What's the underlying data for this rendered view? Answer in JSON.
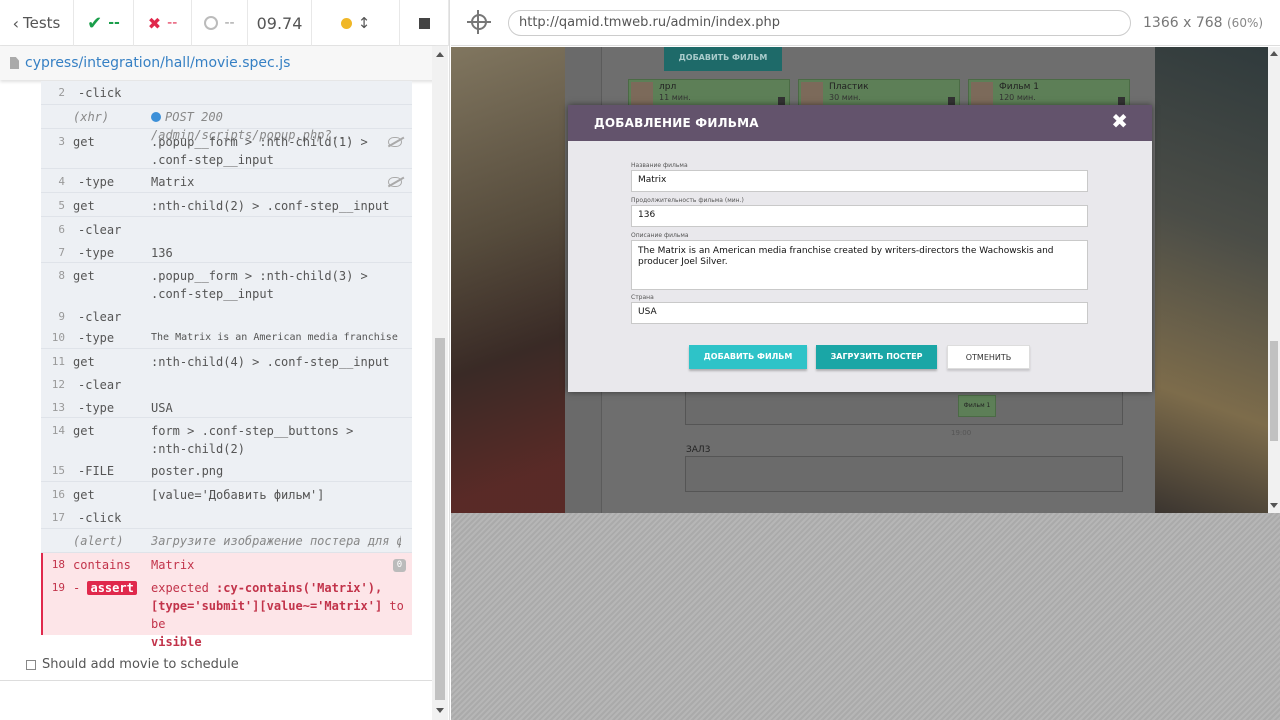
{
  "header": {
    "tests_label": "Tests",
    "passed": "--",
    "failed": "--",
    "pending": "--",
    "duration": "09.74"
  },
  "spec": {
    "path": "cypress/integration/hall/movie.spec.js"
  },
  "commands": [
    {
      "num": "2",
      "name": "-click",
      "msg": ""
    },
    {
      "num": "",
      "name": "(xhr)",
      "msg": "POST 200 /admin/scripts/popup.php?..."
    },
    {
      "num": "3",
      "name": "get",
      "msg": ".popup__form > :nth-child(1) > .conf-step__input"
    },
    {
      "num": "4",
      "name": "-type",
      "msg": "Matrix"
    },
    {
      "num": "5",
      "name": "get",
      "msg": ":nth-child(2) > .conf-step__input"
    },
    {
      "num": "6",
      "name": "-clear",
      "msg": ""
    },
    {
      "num": "7",
      "name": "-type",
      "msg": "136"
    },
    {
      "num": "8",
      "name": "get",
      "msg": ".popup__form > :nth-child(3) > .conf-step__input"
    },
    {
      "num": "9",
      "name": "-clear",
      "msg": ""
    },
    {
      "num": "10",
      "name": "-type",
      "msg": "The Matrix is an American media franchise cr..."
    },
    {
      "num": "11",
      "name": "get",
      "msg": ":nth-child(4) > .conf-step__input"
    },
    {
      "num": "12",
      "name": "-clear",
      "msg": ""
    },
    {
      "num": "13",
      "name": "-type",
      "msg": "USA"
    },
    {
      "num": "14",
      "name": "get",
      "msg": "form > .conf-step__buttons > :nth-child(2)"
    },
    {
      "num": "15",
      "name": "-FILE",
      "msg": "poster.png"
    },
    {
      "num": "16",
      "name": "get",
      "msg": "[value='Добавить фильм']"
    },
    {
      "num": "17",
      "name": "-click",
      "msg": ""
    },
    {
      "num": "",
      "name": "(alert)",
      "msg": "Загрузите изображение постера для фил..."
    }
  ],
  "failed_commands": {
    "contains_num": "18",
    "contains_name": "contains",
    "contains_msg": "Matrix",
    "contains_count": "0",
    "assert_num": "19",
    "assert_dash": "-",
    "assert_name": "assert",
    "assert_msg_1": "expected",
    "assert_msg_2": ":cy-contains('Matrix'),",
    "assert_msg_3": "[type='submit'][value~='Matrix']",
    "assert_msg_4": "to be",
    "assert_msg_5": "visible"
  },
  "next_test": {
    "label": "Should add movie to schedule"
  },
  "aut": {
    "url": "http://qamid.tmweb.ru/admin/index.php",
    "viewport": "1366 x 768",
    "zoom": "(60%)"
  },
  "admin_page": {
    "add_film_btn": "ДОБАВИТЬ ФИЛЬМ",
    "films": [
      {
        "title": "лрл",
        "duration": "11 мин."
      },
      {
        "title": "Пластик",
        "duration": "30 мин."
      },
      {
        "title": "Фильм 1",
        "duration": "120 мин."
      }
    ],
    "slot_title": "Фильм 1",
    "slot_time": "19:00",
    "hall_label": "ЗАЛ3"
  },
  "modal": {
    "title": "ДОБАВЛЕНИЕ ФИЛЬМА",
    "close": "✖",
    "name_label": "Название фильма",
    "name_value": "Matrix",
    "duration_label": "Продолжительность фильма (мин.)",
    "duration_value": "136",
    "description_label": "Описание фильма",
    "description_value": "The Matrix is an American media franchise created by writers-directors the Wachowskis and producer Joel Silver.",
    "country_label": "Страна",
    "country_value": "USA",
    "add_button": "ДОБАВИТЬ ФИЛЬМ",
    "upload_button": "ЗАГРУЗИТЬ ПОСТЕР",
    "cancel_button": "ОТМЕНИТЬ"
  },
  "colors": {
    "pass": "#1a9e4a",
    "fail": "#e0294c",
    "modal_header": "#63536c",
    "accent_teal": "#2ec3c8"
  }
}
